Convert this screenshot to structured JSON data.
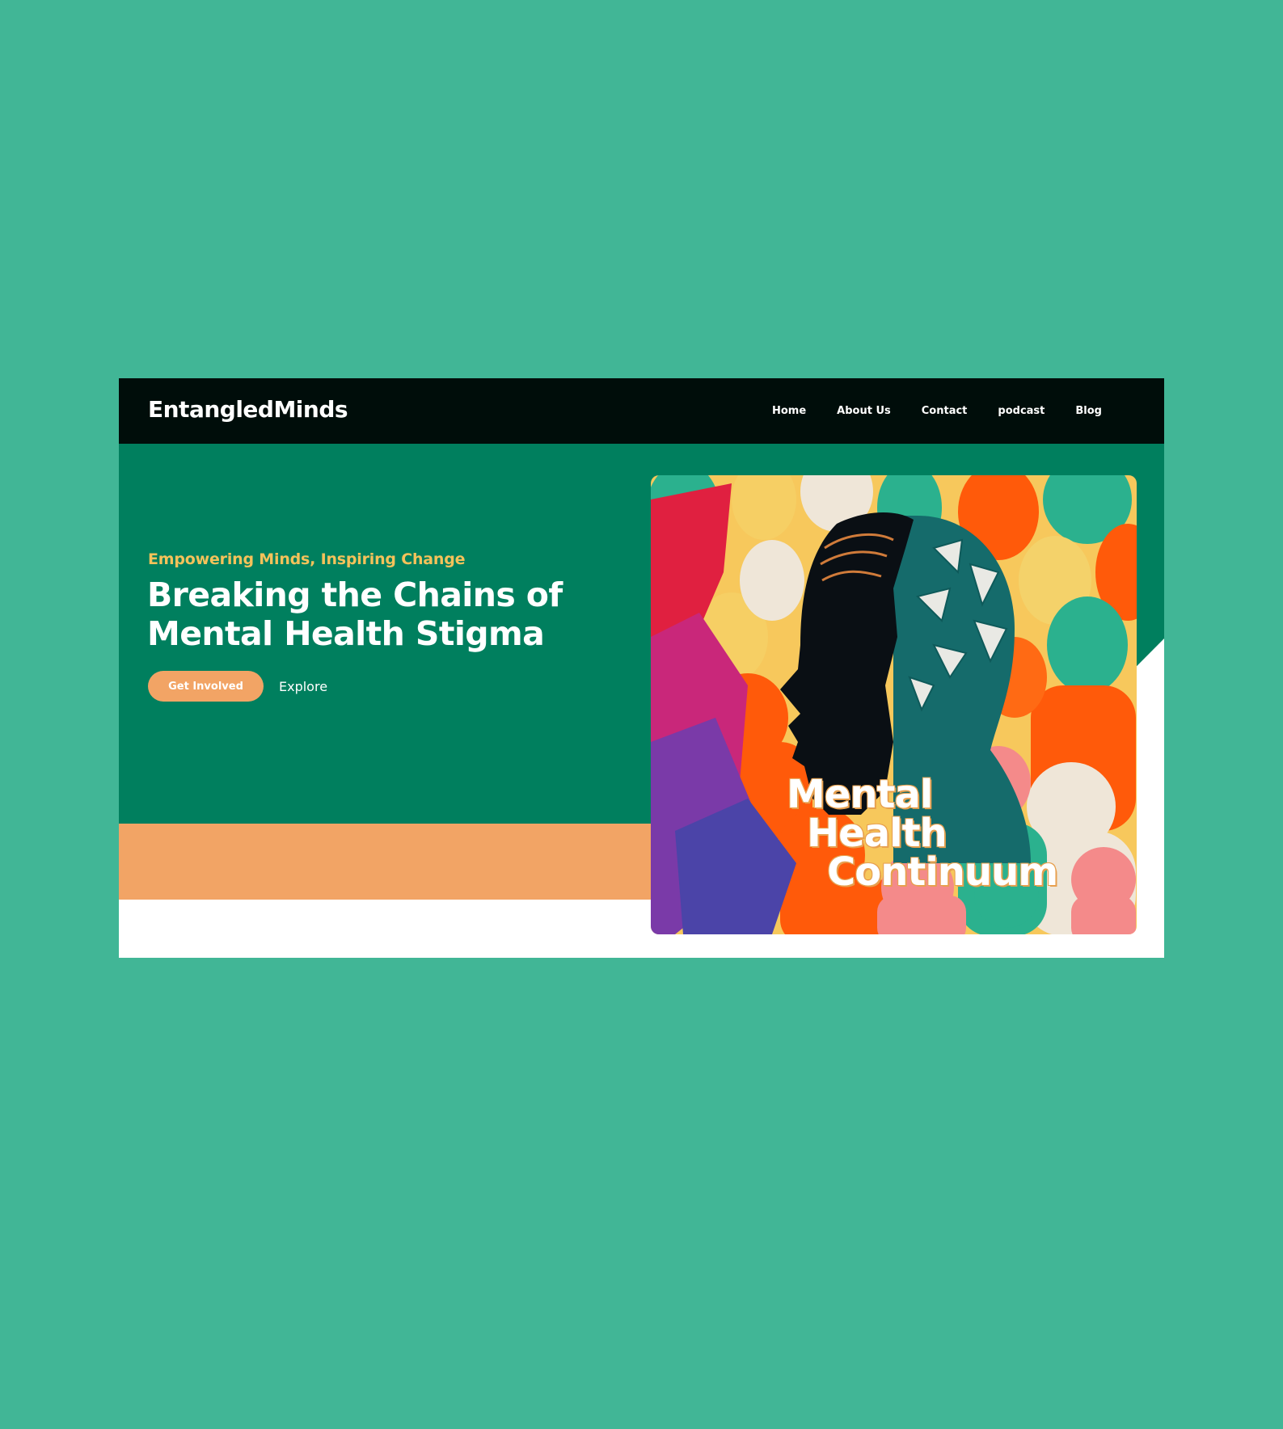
{
  "brand": {
    "name": "EntangledMinds"
  },
  "nav": {
    "items": [
      {
        "label": "Home"
      },
      {
        "label": "About Us"
      },
      {
        "label": "Contact"
      },
      {
        "label": "podcast"
      },
      {
        "label": "Blog"
      }
    ]
  },
  "hero": {
    "tagline": "Empowering Minds, Inspiring Change",
    "headline": "Breaking the Chains of Mental Health Stigma",
    "primary_button": "Get Involved",
    "secondary_link": "Explore",
    "artwork": {
      "title_line1": "Mental",
      "title_line2": "Health",
      "title_line3": "Continuum"
    }
  },
  "colors": {
    "page_background": "#41b696",
    "nav_background": "#000d0a",
    "hero_background": "#007f5e",
    "accent_orange": "#f2a465",
    "tagline_yellow": "#f4c25a"
  }
}
